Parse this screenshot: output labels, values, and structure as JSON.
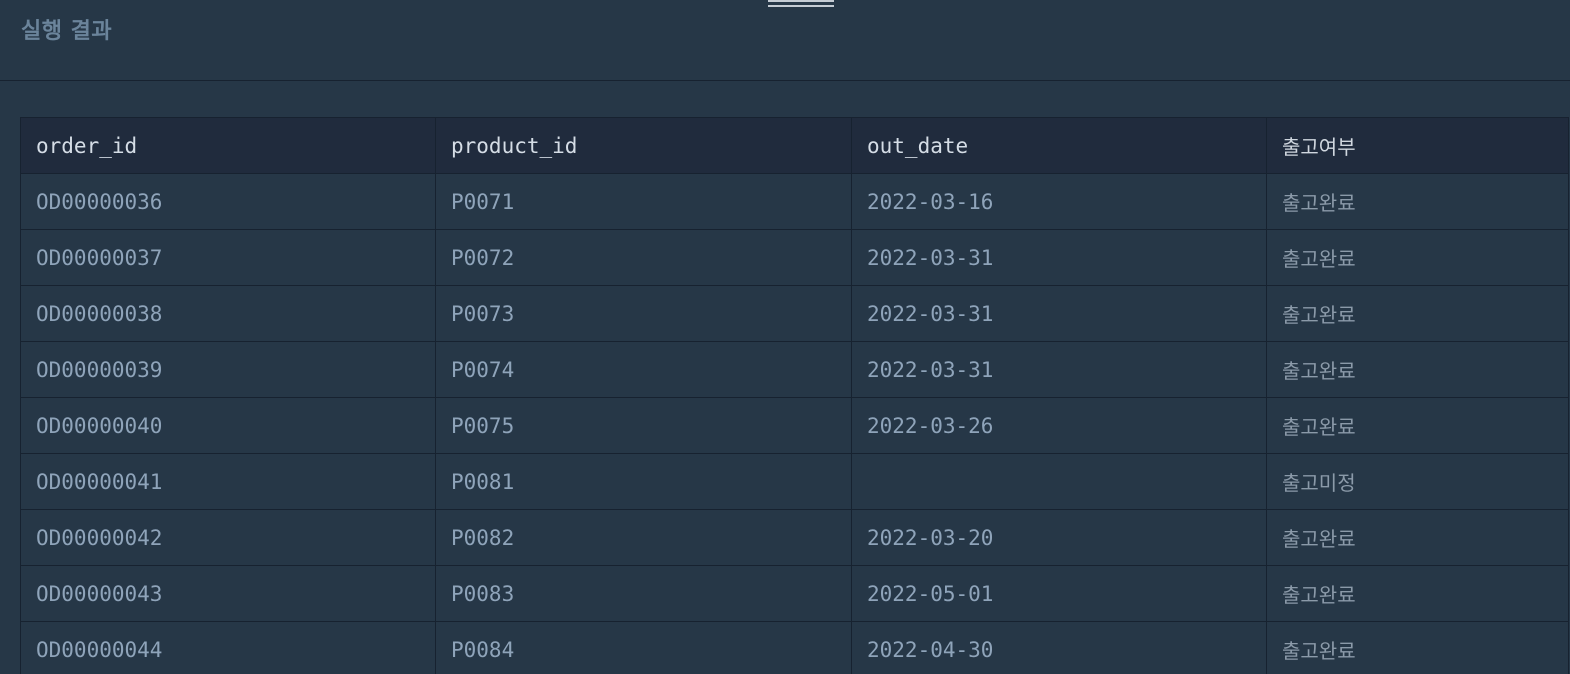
{
  "panel": {
    "title": "실행 결과"
  },
  "table": {
    "columns": [
      "order_id",
      "product_id",
      "out_date",
      "출고여부"
    ],
    "rows": [
      [
        "OD00000036",
        "P0071",
        "2022-03-16",
        "출고완료"
      ],
      [
        "OD00000037",
        "P0072",
        "2022-03-31",
        "출고완료"
      ],
      [
        "OD00000038",
        "P0073",
        "2022-03-31",
        "출고완료"
      ],
      [
        "OD00000039",
        "P0074",
        "2022-03-31",
        "출고완료"
      ],
      [
        "OD00000040",
        "P0075",
        "2022-03-26",
        "출고완료"
      ],
      [
        "OD00000041",
        "P0081",
        "",
        "출고미정"
      ],
      [
        "OD00000042",
        "P0082",
        "2022-03-20",
        "출고완료"
      ],
      [
        "OD00000043",
        "P0083",
        "2022-05-01",
        "출고완료"
      ],
      [
        "OD00000044",
        "P0084",
        "2022-04-30",
        "출고완료"
      ]
    ]
  },
  "colors": {
    "background": "#263747",
    "header_row": "#202b3d",
    "border": "#172230",
    "title_text": "#6b849b",
    "cell_text": "#8fa4ba",
    "header_text": "#d5dde6"
  },
  "icons": {
    "drag_handle": "resize-handle-icon"
  }
}
